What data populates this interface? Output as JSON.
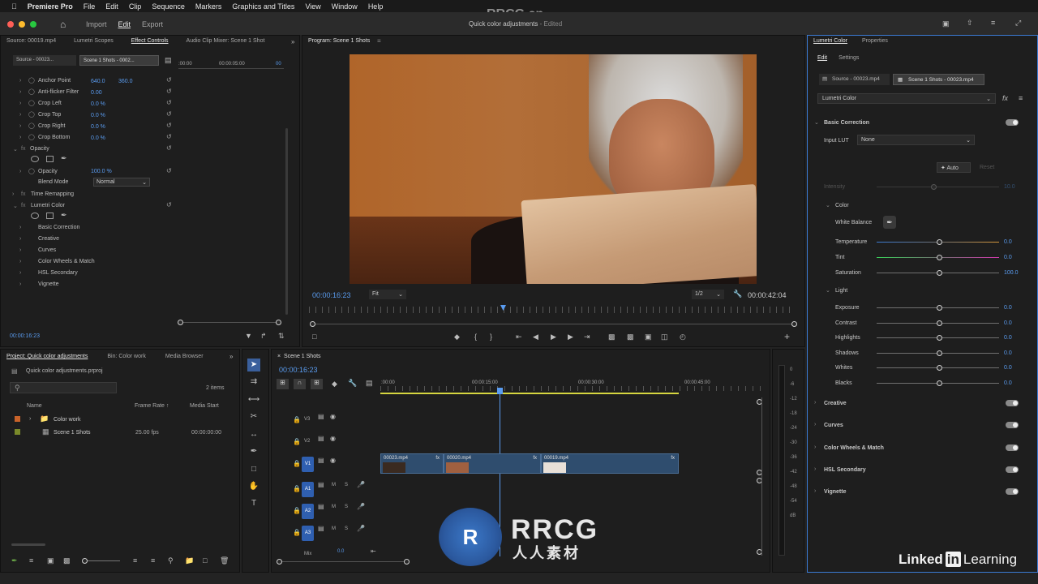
{
  "menu": {
    "app": "Premiere Pro",
    "items": [
      "File",
      "Edit",
      "Clip",
      "Sequence",
      "Markers",
      "Graphics and Titles",
      "View",
      "Window",
      "Help"
    ]
  },
  "titlebar": {
    "home_icon": "home-icon",
    "tabs": [
      "Import",
      "Edit",
      "Export"
    ],
    "active": "Edit",
    "doc_title": "Quick color adjustments",
    "doc_status": " - Edited"
  },
  "effect_panel": {
    "tabs": [
      "Source: 00019.mp4",
      "Lumetri Scopes",
      "Effect Controls",
      "Audio Clip Mixer: Scene 1 Shot"
    ],
    "source_chip": "Source - 00023...",
    "seq_chip": "Scene 1 Shots - 0002...",
    "mini_tc": [
      ":00:00",
      "00:00:05:00",
      "00"
    ],
    "props": [
      {
        "label": "Anchor Point",
        "v1": "640.0",
        "v2": "360.0"
      },
      {
        "label": "Anti-flicker Filter",
        "v1": "0.00"
      },
      {
        "label": "Crop Left",
        "v1": "0.0 %"
      },
      {
        "label": "Crop Top",
        "v1": "0.0 %"
      },
      {
        "label": "Crop Right",
        "v1": "0.0 %"
      },
      {
        "label": "Crop Bottom",
        "v1": "0.0 %"
      }
    ],
    "opacity": "Opacity",
    "opacity_prop": "Opacity",
    "opacity_val": "100.0 %",
    "blend_label": "Blend Mode",
    "blend_val": "Normal",
    "time_remap": "Time Remapping",
    "lumetri": "Lumetri Color",
    "lumetri_items": [
      "Basic Correction",
      "Creative",
      "Curves",
      "Color Wheels & Match",
      "HSL Secondary",
      "Vignette"
    ],
    "timecode": "00:00:16:23"
  },
  "program": {
    "tab": "Program: Scene 1 Shots",
    "timecode": "00:00:16:23",
    "fit": "Fit",
    "res": "1/2",
    "duration": "00:00:42:04"
  },
  "project": {
    "tabs": [
      "Project: Quick color adjustments",
      "Bin: Color work",
      "Media Browser"
    ],
    "file": "Quick color adjustments.prproj",
    "count": "2 items",
    "cols": [
      "Name",
      "Frame Rate",
      "Media Start"
    ],
    "rows": [
      {
        "name": "Color work",
        "rate": "",
        "start": ""
      },
      {
        "name": "Scene 1 Shots",
        "rate": "25.00 fps",
        "start": "00:00:00:00"
      }
    ]
  },
  "timeline": {
    "tab": "Scene 1 Shots",
    "timecode": "00:00:16:23",
    "ruler": [
      ":00:00",
      "00:00:15:00",
      "00:00:30:00",
      "00:00:45:00"
    ],
    "tracks_v": [
      "V3",
      "V2",
      "V1"
    ],
    "tracks_a": [
      "A1",
      "A2",
      "A3"
    ],
    "m": "M",
    "s": "S",
    "mix": "Mix",
    "mix_val": "0.0",
    "clips": [
      {
        "label": "00023.mp4",
        "fx": "fx"
      },
      {
        "label": "00020.mp4",
        "fx": "fx"
      },
      {
        "label": "00019.mp4",
        "fx": "fx"
      }
    ],
    "meter": [
      "0",
      "-6",
      "-12",
      "-18",
      "-24",
      "-30",
      "-36",
      "-42",
      "-48",
      "-54",
      "dB"
    ]
  },
  "lumetri": {
    "tabs": [
      "Lumetri Color",
      "Properties"
    ],
    "subtabs": [
      "Edit",
      "Settings"
    ],
    "source_chip": "Source - 00023.mp4",
    "seq_chip": "Scene 1 Shots - 00023.mp4",
    "effect_select": "Lumetri Color",
    "fx": "fx",
    "basic": "Basic Correction",
    "input_lut": "Input LUT",
    "lut_val": "None",
    "auto": "Auto",
    "reset": "Reset",
    "intensity": "Intensity",
    "intensity_val": "10.0",
    "color": "Color",
    "wb": "White Balance",
    "color_rows": [
      {
        "label": "Temperature",
        "val": "0.0"
      },
      {
        "label": "Tint",
        "val": "0.0"
      },
      {
        "label": "Saturation",
        "val": "100.0"
      }
    ],
    "light": "Light",
    "light_rows": [
      {
        "label": "Exposure",
        "val": "0.0"
      },
      {
        "label": "Contrast",
        "val": "0.0"
      },
      {
        "label": "Highlights",
        "val": "0.0"
      },
      {
        "label": "Shadows",
        "val": "0.0"
      },
      {
        "label": "Whites",
        "val": "0.0"
      },
      {
        "label": "Blacks",
        "val": "0.0"
      }
    ],
    "sections": [
      "Creative",
      "Curves",
      "Color Wheels & Match",
      "HSL Secondary",
      "Vignette"
    ]
  },
  "watermark": {
    "brand": "Linked",
    "brand2": "in",
    "learning": "Learning",
    "rrcg": "RRCG.cn",
    "rrcg_big": "RRCG",
    "rrcg_sub": "人人素材"
  }
}
